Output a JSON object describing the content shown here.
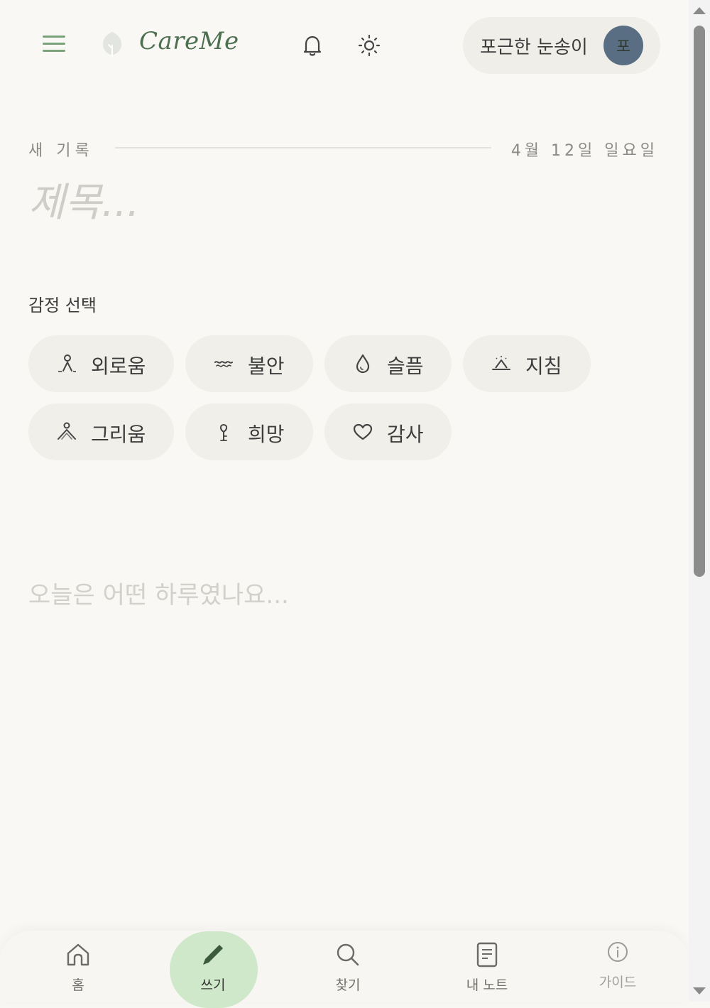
{
  "app": {
    "name": "CareMe"
  },
  "header": {
    "menu_icon": "hamburger-menu-icon",
    "logo_icon": "leaf-icon",
    "notification_icon": "bell-icon",
    "theme_icon": "sun-icon",
    "user_name": "포근한 눈송이",
    "avatar_initial": "포",
    "accent": "#7aa37a"
  },
  "record": {
    "label": "새 기록",
    "date": "4월 12일 일요일",
    "title_placeholder": "제목...",
    "body_placeholder": "오늘은 어떤 하루였나요..."
  },
  "emotions": {
    "label": "감정 선택",
    "items": [
      {
        "label": "외로움",
        "icon": "lonely-person-icon"
      },
      {
        "label": "불안",
        "icon": "wave-icon"
      },
      {
        "label": "슬픔",
        "icon": "drop-icon"
      },
      {
        "label": "지침",
        "icon": "sunset-icon"
      },
      {
        "label": "그리움",
        "icon": "person-arms-icon"
      },
      {
        "label": "희망",
        "icon": "sprout-icon"
      },
      {
        "label": "감사",
        "icon": "heart-icon"
      }
    ]
  },
  "bottom_nav": {
    "items": [
      {
        "label": "홈",
        "icon": "home-icon"
      },
      {
        "label": "쓰기",
        "icon": "pencil-icon",
        "active": true
      },
      {
        "label": "찾기",
        "icon": "search-icon"
      },
      {
        "label": "내 노트",
        "icon": "note-icon"
      },
      {
        "label": "가이드",
        "icon": "info-icon"
      }
    ],
    "active_color": "#cfe8c9"
  }
}
